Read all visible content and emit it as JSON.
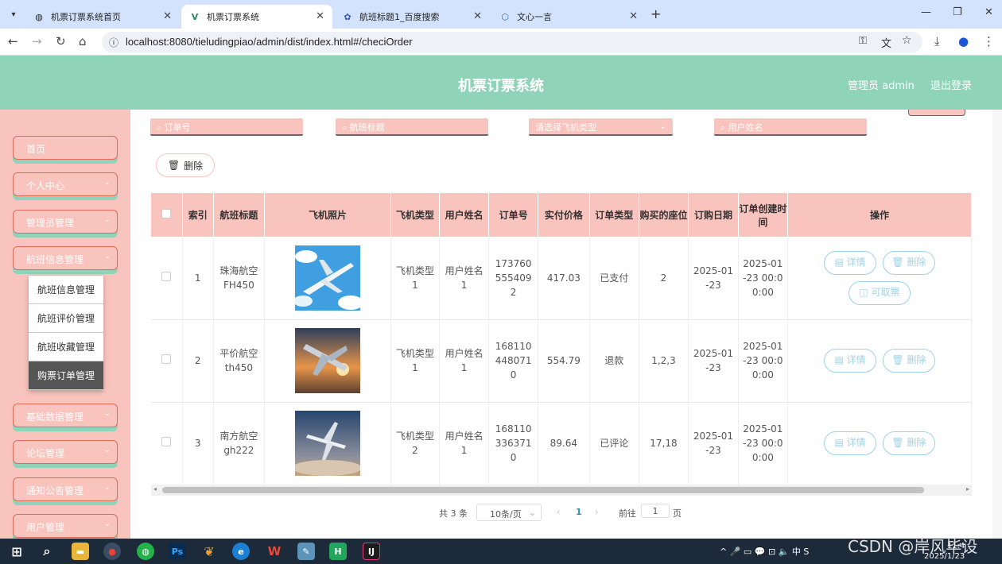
{
  "browser": {
    "tabs": [
      {
        "label": "机票订票系统首页",
        "icon": "globe-icon",
        "active": false
      },
      {
        "label": "机票订票系统",
        "icon": "vue-logo-icon",
        "active": true
      },
      {
        "label": "航班标题1_百度搜索",
        "icon": "baidu-paw-icon",
        "active": false
      },
      {
        "label": "文心一言",
        "icon": "cube-icon",
        "active": false
      }
    ],
    "url": "localhost:8080/tieludingpiao/admin/dist/index.html#/checiOrder"
  },
  "header": {
    "title": "机票订票系统",
    "admin_label": "管理员 admin",
    "logout_label": "退出登录"
  },
  "sidebar": {
    "items": [
      {
        "label": "首页",
        "has_chevron": false
      },
      {
        "label": "个人中心",
        "has_chevron": true
      },
      {
        "label": "管理员管理",
        "has_chevron": true
      },
      {
        "label": "航班信息管理",
        "has_chevron": true
      },
      {
        "label": "基础数据管理",
        "has_chevron": true
      },
      {
        "label": "论坛管理",
        "has_chevron": true
      },
      {
        "label": "通知公告管理",
        "has_chevron": true
      },
      {
        "label": "用户管理",
        "has_chevron": true
      }
    ],
    "submenu": [
      {
        "label": "航班信息管理",
        "active": false
      },
      {
        "label": "航班评价管理",
        "active": false
      },
      {
        "label": "航班收藏管理",
        "active": false
      },
      {
        "label": "购票订单管理",
        "active": true
      }
    ]
  },
  "search": {
    "order_no_placeholder": "订单号",
    "flight_title_placeholder": "航班标题",
    "plane_type_placeholder": "请选择飞机类型",
    "username_placeholder": "用户姓名"
  },
  "toolbar": {
    "delete_label": "删除"
  },
  "table": {
    "headers": [
      "索引",
      "航班标题",
      "飞机照片",
      "飞机类型",
      "用户姓名",
      "订单号",
      "实付价格",
      "订单类型",
      "购买的座位",
      "订购日期",
      "订单创建时间",
      "操作"
    ],
    "rows": [
      {
        "index": "1",
        "title": "珠海航空FH450",
        "plane_type": "飞机类型1",
        "user": "用户姓名1",
        "order_no": "1737605554092",
        "price": "417.03",
        "order_type": "已支付",
        "seats": "2",
        "date": "2025-01-23",
        "created": "2025-01-23 00:00:00",
        "actions": [
          "详情",
          "删除",
          "可取票"
        ]
      },
      {
        "index": "2",
        "title": "平价航空th450",
        "plane_type": "飞机类型1",
        "user": "用户姓名1",
        "order_no": "1681104480710",
        "price": "554.79",
        "order_type": "退款",
        "seats": "1,2,3",
        "date": "2025-01-23",
        "created": "2025-01-23 00:00:00",
        "actions": [
          "详情",
          "删除"
        ]
      },
      {
        "index": "3",
        "title": "南方航空gh222",
        "plane_type": "飞机类型2",
        "user": "用户姓名1",
        "order_no": "1681103363710",
        "price": "89.64",
        "order_type": "已评论",
        "seats": "17,18",
        "date": "2025-01-23",
        "created": "2025-01-23 00:00:00",
        "actions": [
          "详情",
          "删除"
        ]
      }
    ]
  },
  "pager": {
    "total": "共 3 条",
    "page_size": "10条/页",
    "current_page": "1",
    "goto_label": "前往",
    "goto_value": "1",
    "page_suffix": "页"
  },
  "taskbar": {
    "tray": "^ 🎤 ▭ 💬 ⊡ 🔈 中 S",
    "clock_time": "11:4",
    "clock_date": "2025/1/23"
  },
  "watermark": "CSDN @岸风毕设",
  "colors": {
    "header": "#8fd3b8",
    "sidebar": "#f9c4bd",
    "action_button": "#9fd3e6"
  }
}
